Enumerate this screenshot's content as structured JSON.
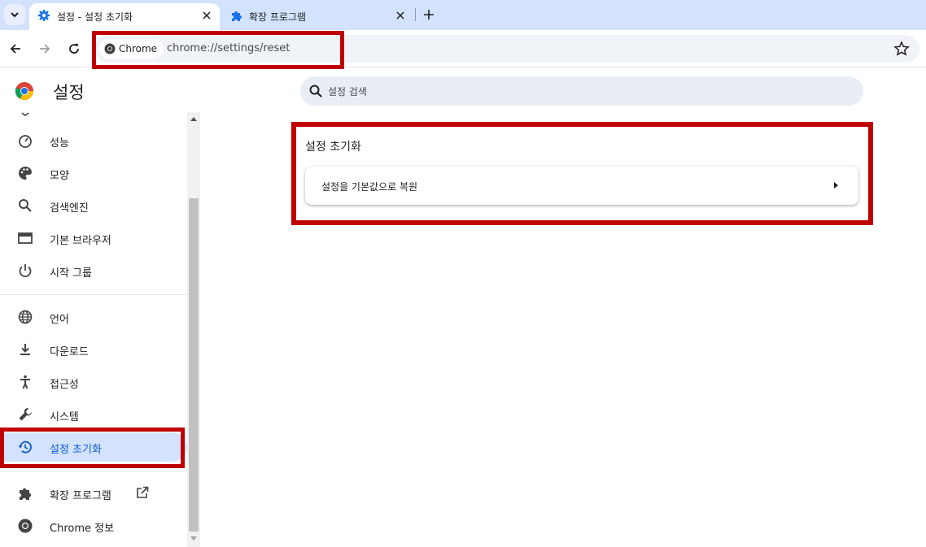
{
  "tabs": [
    {
      "title": "설정 - 설정 초기화",
      "icon": "gear-icon",
      "active": true
    },
    {
      "title": "확장 프로그램",
      "icon": "puzzle-icon",
      "active": false
    }
  ],
  "toolbar": {
    "chip_label": "Chrome",
    "url": "chrome://settings/reset"
  },
  "settings": {
    "title": "설정",
    "search_placeholder": "설정 검색"
  },
  "sidebar": {
    "items": [
      {
        "label": "성능",
        "icon": "speedometer-icon"
      },
      {
        "label": "모양",
        "icon": "palette-icon"
      },
      {
        "label": "검색엔진",
        "icon": "search-icon"
      },
      {
        "label": "기본 브라우저",
        "icon": "browser-window-icon"
      },
      {
        "label": "시작 그룹",
        "icon": "power-icon"
      },
      {
        "label": "언어",
        "icon": "globe-icon"
      },
      {
        "label": "다운로드",
        "icon": "download-icon"
      },
      {
        "label": "접근성",
        "icon": "accessibility-icon"
      },
      {
        "label": "시스템",
        "icon": "wrench-icon"
      },
      {
        "label": "설정 초기화",
        "icon": "history-reset-icon",
        "selected": true
      },
      {
        "label": "확장 프로그램",
        "icon": "puzzle-icon"
      },
      {
        "label": "Chrome 정보",
        "icon": "chrome-icon"
      }
    ]
  },
  "main": {
    "section_title": "설정 초기화",
    "reset_row_label": "설정을 기본값으로 복원"
  },
  "colors": {
    "highlight": "#c00000",
    "accent": "#0b57d0",
    "selected_bg": "#d3e3fd"
  }
}
